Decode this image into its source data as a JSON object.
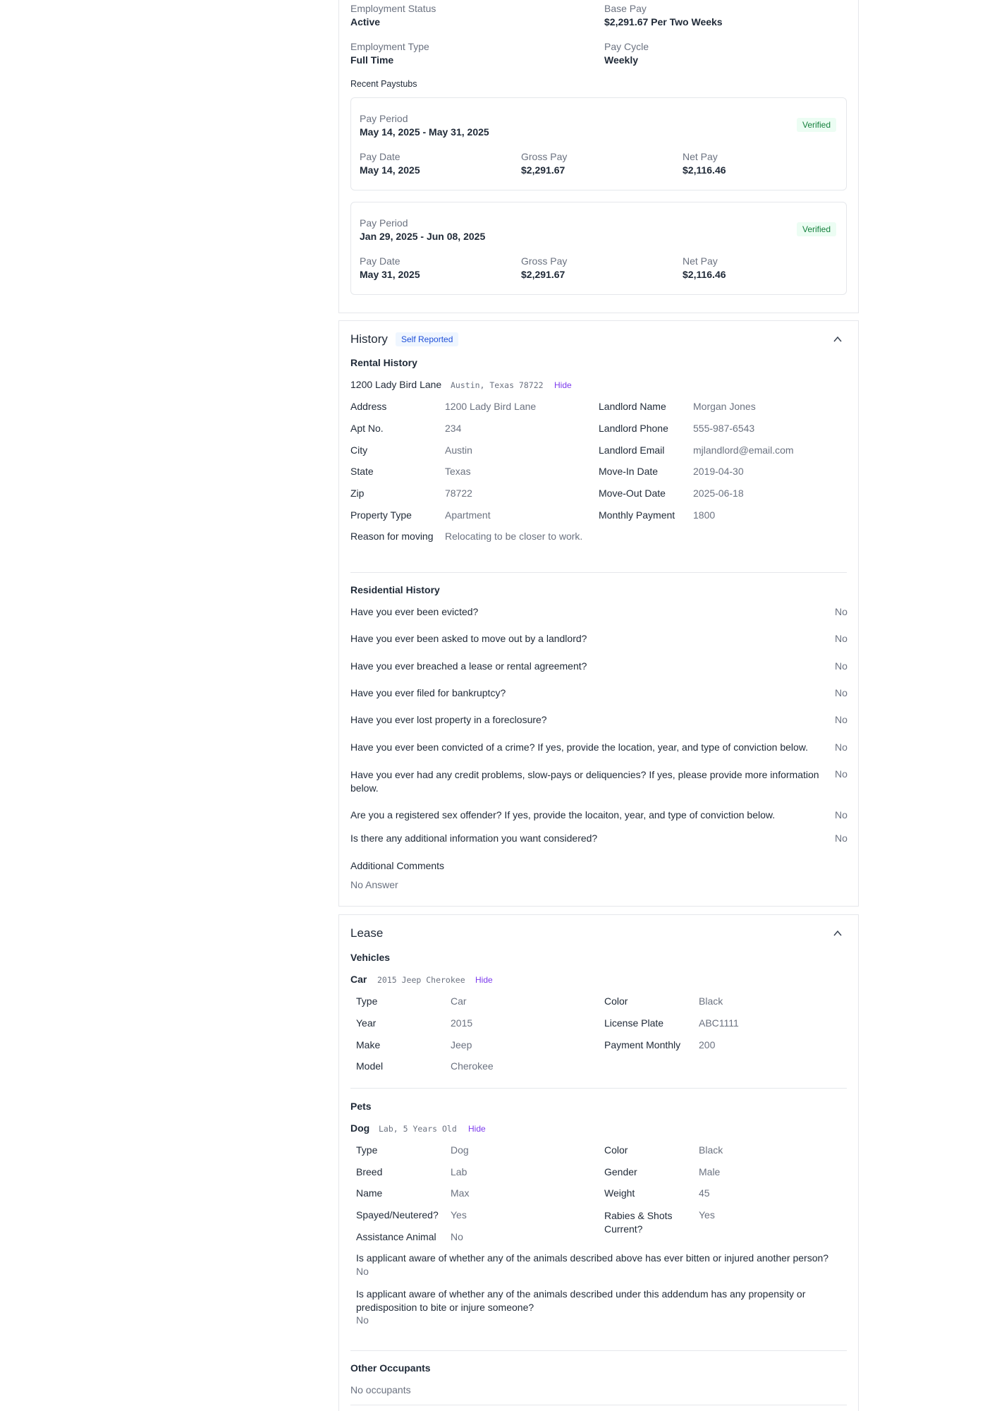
{
  "employment": {
    "status_label": "Employment Status",
    "status_value": "Active",
    "base_pay_label": "Base Pay",
    "base_pay_value": "$2,291.67 Per Two Weeks",
    "type_label": "Employment Type",
    "type_value": "Full Time",
    "cycle_label": "Pay Cycle",
    "cycle_value": "Weekly",
    "paystubs_heading": "Recent Paystubs",
    "paystubs": [
      {
        "period_label": "Pay Period",
        "period_value": "May 14, 2025 - May 31, 2025",
        "badge": "Verified",
        "date_label": "Pay Date",
        "date_value": "May 14, 2025",
        "gross_label": "Gross Pay",
        "gross_value": "$2,291.67",
        "net_label": "Net Pay",
        "net_value": "$2,116.46"
      },
      {
        "period_label": "Pay Period",
        "period_value": "Jan 29, 2025 - Jun 08, 2025",
        "badge": "Verified",
        "date_label": "Pay Date",
        "date_value": "May 31, 2025",
        "gross_label": "Gross Pay",
        "gross_value": "$2,291.67",
        "net_label": "Net Pay",
        "net_value": "$2,116.46"
      }
    ]
  },
  "history": {
    "title": "History",
    "badge": "Self Reported",
    "rental_heading": "Rental History",
    "rental_entry": {
      "name": "1200 Lady Bird Lane",
      "location": "Austin, Texas 78722",
      "hide_label": "Hide",
      "left": [
        {
          "label": "Address",
          "value": "1200 Lady Bird Lane"
        },
        {
          "label": "Apt No.",
          "value": "234"
        },
        {
          "label": "City",
          "value": "Austin"
        },
        {
          "label": "State",
          "value": "Texas"
        },
        {
          "label": "Zip",
          "value": "78722"
        },
        {
          "label": "Property Type",
          "value": "Apartment"
        },
        {
          "label": "Reason for moving",
          "value": "Relocating to be closer to work."
        }
      ],
      "right": [
        {
          "label": "Landlord Name",
          "value": "Morgan Jones"
        },
        {
          "label": "Landlord Phone",
          "value": "555-987-6543"
        },
        {
          "label": "Landlord Email",
          "value": "mjlandlord@email.com"
        },
        {
          "label": "Move-In Date",
          "value": "2019-04-30"
        },
        {
          "label": "Move-Out Date",
          "value": "2025-06-18"
        },
        {
          "label": "Monthly Payment",
          "value": "1800"
        }
      ]
    },
    "residential_heading": "Residential History",
    "questions": [
      {
        "q": "Have you ever been evicted?",
        "a": "No"
      },
      {
        "q": "Have you ever been asked to move out by a landlord?",
        "a": "No"
      },
      {
        "q": "Have you ever breached a lease or rental agreement?",
        "a": "No"
      },
      {
        "q": "Have you ever filed for bankruptcy?",
        "a": "No"
      },
      {
        "q": "Have you ever lost property in a foreclosure?",
        "a": "No"
      },
      {
        "q": "Have you ever been convicted of a crime? If yes, provide the location, year, and type of conviction below.",
        "a": "No"
      },
      {
        "q": "Have you ever had any credit problems, slow-pays or deliquencies? If yes, please provide more information below.",
        "a": "No"
      },
      {
        "q": "Are you a registered sex offender? If yes, provide the locaiton, year, and type of conviction below.",
        "a": "No"
      },
      {
        "q": "Is there any additional information you want considered?",
        "a": "No"
      }
    ],
    "comments_label": "Additional Comments",
    "comments_value": "No Answer"
  },
  "lease": {
    "title": "Lease",
    "vehicles_heading": "Vehicles",
    "vehicle": {
      "name": "Car",
      "desc": "2015 Jeep Cherokee",
      "hide_label": "Hide",
      "left": [
        {
          "label": "Type",
          "value": "Car"
        },
        {
          "label": "Year",
          "value": "2015"
        },
        {
          "label": "Make",
          "value": "Jeep"
        },
        {
          "label": "Model",
          "value": "Cherokee"
        }
      ],
      "right": [
        {
          "label": "Color",
          "value": "Black"
        },
        {
          "label": "License Plate",
          "value": "ABC1111"
        },
        {
          "label": "Payment Monthly",
          "value": "200"
        }
      ]
    },
    "pets_heading": "Pets",
    "pet": {
      "name": "Dog",
      "desc": "Lab, 5 Years Old",
      "hide_label": "Hide",
      "left": [
        {
          "label": "Type",
          "value": "Dog"
        },
        {
          "label": "Breed",
          "value": "Lab"
        },
        {
          "label": "Name",
          "value": "Max"
        },
        {
          "label": "Spayed/Neutered?",
          "value": "Yes"
        },
        {
          "label": "Assistance Animal",
          "value": "No"
        }
      ],
      "right": [
        {
          "label": "Color",
          "value": "Black"
        },
        {
          "label": "Gender",
          "value": "Male"
        },
        {
          "label": "Weight",
          "value": "45"
        },
        {
          "label": "Rabies & Shots Current?",
          "value": "Yes"
        }
      ],
      "q1": "Is applicant aware of whether any of the animals described above has ever bitten or injured another person?",
      "a1": "No",
      "q2": "Is applicant aware of whether any of the animals described under this addendum has any propensity or predisposition to bite or injure someone?",
      "a2": "No"
    },
    "occupants_heading": "Other Occupants",
    "occupants_value": "No occupants"
  }
}
